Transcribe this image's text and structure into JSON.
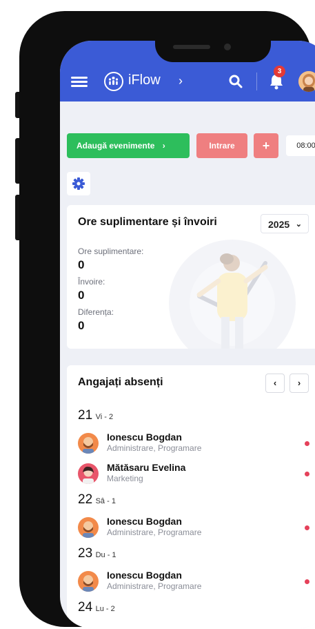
{
  "app": {
    "name": "iFlow",
    "notifications_count": "3"
  },
  "toolbar": {
    "add_events_label": "Adaugă evenimente",
    "add_events_chevron": "›",
    "entry_label": "Intrare",
    "plus_label": "+",
    "time": "08:00"
  },
  "overtime_card": {
    "title": "Ore suplimentare și învoiri",
    "year": "2025",
    "stats": [
      {
        "label": "Ore suplimentare:",
        "value": "0"
      },
      {
        "label": "Învoire:",
        "value": "0"
      },
      {
        "label": "Diferența:",
        "value": "0"
      }
    ]
  },
  "absent_card": {
    "title": "Angajați absenți",
    "prev": "‹",
    "next": "›",
    "days": [
      {
        "num": "21",
        "sub": "Vi - 2",
        "people": [
          {
            "name": "Ionescu Bogdan",
            "dept": "Administrare, Programare"
          },
          {
            "name": "Mătăsaru Evelina",
            "dept": "Marketing"
          }
        ]
      },
      {
        "num": "22",
        "sub": "Sâ - 1",
        "people": [
          {
            "name": "Ionescu Bogdan",
            "dept": "Administrare, Programare"
          }
        ]
      },
      {
        "num": "23",
        "sub": "Du - 1",
        "people": [
          {
            "name": "Ionescu Bogdan",
            "dept": "Administrare, Programare"
          }
        ]
      },
      {
        "num": "24",
        "sub": "Lu - 2",
        "people": []
      }
    ]
  },
  "colors": {
    "brand": "#3b5bd6",
    "success": "#2dbe5c",
    "danger": "#ef7f80",
    "status_dot": "#e5415a"
  }
}
